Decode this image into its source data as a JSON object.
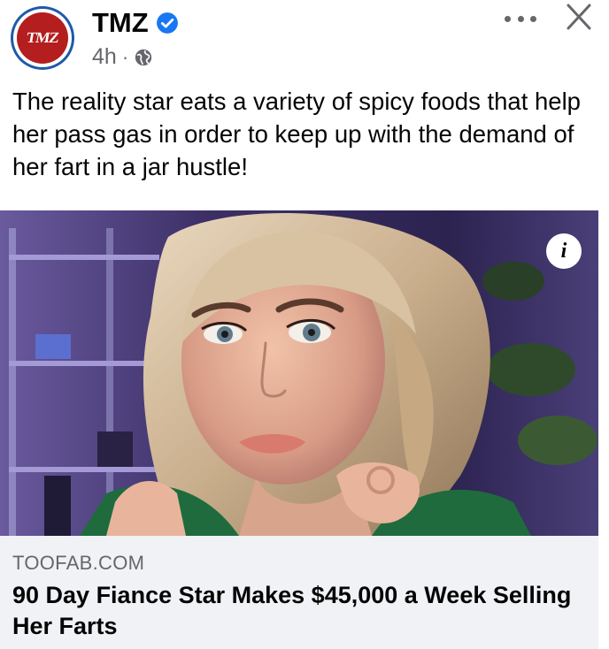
{
  "post": {
    "page_name": "TMZ",
    "avatar_text": "TMZ",
    "timestamp": "4h",
    "separator": "·",
    "audience_icon": "globe-icon",
    "verified_icon": "verified-badge-icon",
    "caption": "The reality star eats a variety of spicy foods that help her pass gas in order to keep up with the demand of her fart in a jar hustle!"
  },
  "controls": {
    "more_icon": "more-options-icon",
    "close_icon": "close-icon"
  },
  "media": {
    "info_label": "i"
  },
  "link_preview": {
    "domain": "TOOFAB.COM",
    "title": "90 Day Fiance Star Makes $45,000 a Week Selling Her Farts"
  },
  "colors": {
    "verified_blue": "#1877f2",
    "secondary_text": "#65676b",
    "link_card_bg": "#f0f2f5",
    "tmz_red": "#b41e1e"
  }
}
